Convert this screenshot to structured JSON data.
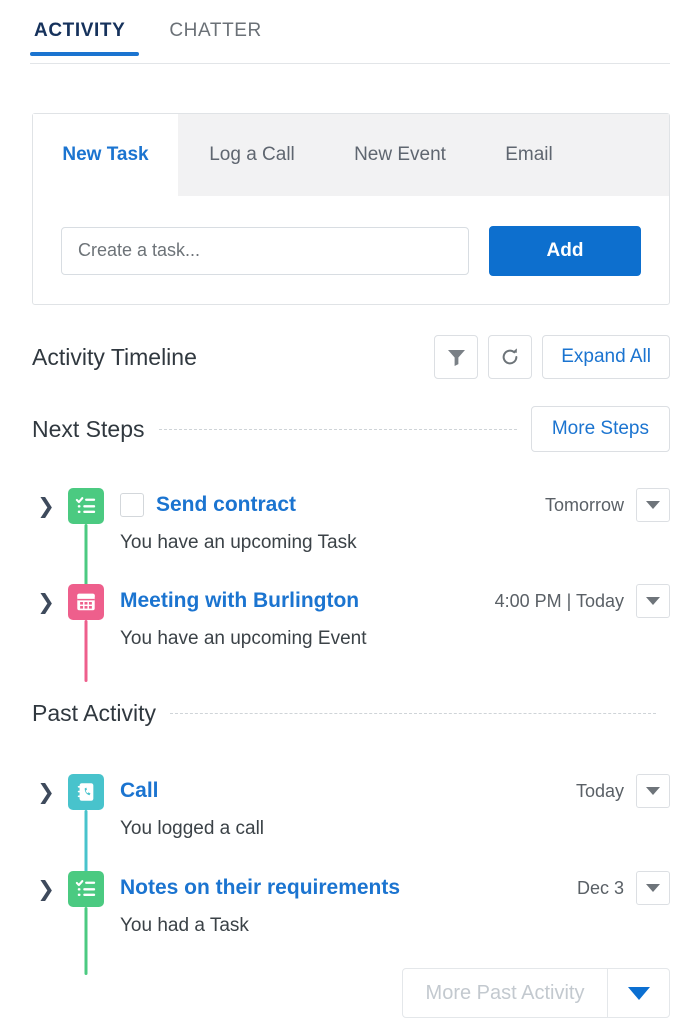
{
  "top_tabs": [
    {
      "label": "ACTIVITY",
      "active": true
    },
    {
      "label": "CHATTER",
      "active": false
    }
  ],
  "composer": {
    "tabs": [
      {
        "label": "New Task",
        "active": true
      },
      {
        "label": "Log a Call",
        "active": false
      },
      {
        "label": "New Event",
        "active": false
      },
      {
        "label": "Email",
        "active": false
      }
    ],
    "input_placeholder": "Create a task...",
    "input_value": "",
    "add_label": "Add"
  },
  "timeline_header": {
    "title": "Activity Timeline",
    "filter_icon": "funnel-icon",
    "refresh_icon": "refresh-icon",
    "expand_all_label": "Expand All"
  },
  "sections": {
    "next_steps": {
      "title": "Next Steps",
      "action_label": "More Steps"
    },
    "past_activity": {
      "title": "Past Activity"
    }
  },
  "items": [
    {
      "icon": "task-checklist-icon",
      "icon_color": "#4bca81",
      "has_checkbox": true,
      "title": "Send contract",
      "date": "Tomorrow",
      "subtitle": "You have an upcoming Task",
      "expand_icon": "chevron-right-icon",
      "menu_icon": "caret-down-icon"
    },
    {
      "icon": "event-calendar-icon",
      "icon_color": "#ee5f8c",
      "has_checkbox": false,
      "title": "Meeting with Burlington",
      "date": "4:00 PM | Today",
      "subtitle": "You have an upcoming Event",
      "expand_icon": "chevron-right-icon",
      "menu_icon": "caret-down-icon"
    },
    {
      "icon": "call-log-icon",
      "icon_color": "#48c3cc",
      "has_checkbox": false,
      "title": "Call",
      "date": "Today",
      "subtitle": "You logged a call",
      "expand_icon": "chevron-right-icon",
      "menu_icon": "caret-down-icon"
    },
    {
      "icon": "task-checklist-icon",
      "icon_color": "#4bca81",
      "has_checkbox": false,
      "title": "Notes on their requirements",
      "date": "Dec 3",
      "subtitle": "You had a Task",
      "expand_icon": "chevron-right-icon",
      "menu_icon": "caret-down-icon"
    }
  ],
  "more_past_activity": {
    "label": "More Past Activity",
    "caret_icon": "caret-down-icon"
  },
  "colors": {
    "link_blue": "#1b74d0",
    "button_blue": "#0d6fce",
    "task_green": "#4bca81",
    "event_pink": "#ee5f8c",
    "call_teal": "#48c3cc"
  }
}
